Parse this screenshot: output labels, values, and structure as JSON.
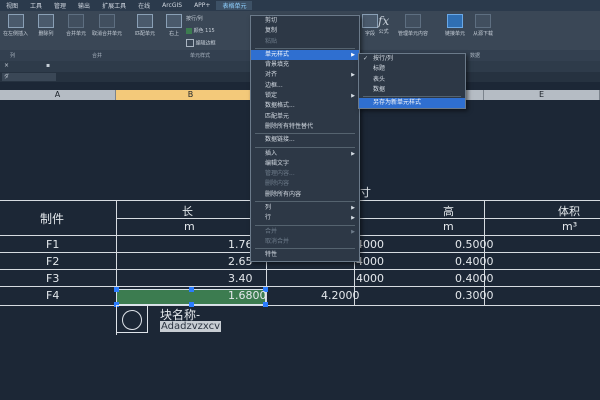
{
  "menubar": [
    "视图",
    "工具",
    "管理",
    "输出",
    "扩展工具",
    "在线",
    "ArcGIS",
    "APP+",
    "表格单元"
  ],
  "menubar_active_index": 8,
  "ribbon": {
    "buttons": [
      {
        "label": "在左侧插入"
      },
      {
        "label": "删除列"
      },
      {
        "label": "合并单元"
      },
      {
        "label": "取消合并单元"
      },
      {
        "label": "匹配单元"
      },
      {
        "label": "右上"
      },
      {
        "label": "按行/列"
      },
      {
        "label": "颜色 115"
      },
      {
        "label": "编辑边框"
      },
      {
        "label": "字段"
      },
      {
        "label": "公式"
      },
      {
        "label": "管理单元内容"
      },
      {
        "label": "链接单元"
      },
      {
        "label": "从源下载"
      }
    ],
    "panels": [
      "列",
      "合并",
      "单元样式",
      "数据"
    ]
  },
  "table": {
    "columns": [
      "A",
      "B",
      "C",
      "D",
      "E"
    ],
    "title_fragment": "寸",
    "header_row": [
      "制件",
      "长",
      "高",
      "体积"
    ],
    "unit_row": [
      "m",
      "m",
      "m³"
    ],
    "rows": [
      {
        "name": "F1",
        "b": "1.76",
        "c": "4000",
        "d": "0.5000"
      },
      {
        "name": "F2",
        "b": "2.65",
        "c": "4000",
        "d": "0.4000"
      },
      {
        "name": "F3",
        "b": "3.40",
        "c": "4000",
        "d": "0.4000"
      },
      {
        "name": "F4",
        "b": "1.6800",
        "c": "4.2000",
        "d": "0.3000"
      }
    ],
    "block_label": "块名称-",
    "block_value": "Adadzvzxcv"
  },
  "context_menu": {
    "items": [
      {
        "label": "剪切",
        "state": "normal"
      },
      {
        "label": "复制",
        "state": "normal"
      },
      {
        "label": "粘贴",
        "state": "disabled"
      },
      {
        "sep": true
      },
      {
        "label": "单元样式",
        "state": "highlight",
        "sub": true
      },
      {
        "label": "背景填充",
        "state": "normal"
      },
      {
        "label": "对齐",
        "state": "normal",
        "sub": true
      },
      {
        "label": "边框...",
        "state": "normal"
      },
      {
        "label": "锁定",
        "state": "normal",
        "sub": true
      },
      {
        "label": "数据格式...",
        "state": "normal"
      },
      {
        "label": "匹配单元",
        "state": "normal"
      },
      {
        "label": "删除所有特性替代",
        "state": "normal"
      },
      {
        "sep": true
      },
      {
        "label": "数据链接...",
        "state": "normal"
      },
      {
        "sep": true
      },
      {
        "label": "插入",
        "state": "normal",
        "sub": true
      },
      {
        "label": "编辑文字",
        "state": "normal"
      },
      {
        "label": "管理内容...",
        "state": "disabled"
      },
      {
        "label": "删除内容",
        "state": "disabled"
      },
      {
        "label": "删除所有内容",
        "state": "normal"
      },
      {
        "sep": true
      },
      {
        "label": "列",
        "state": "normal",
        "sub": true
      },
      {
        "label": "行",
        "state": "normal",
        "sub": true
      },
      {
        "sep": true
      },
      {
        "label": "合并",
        "state": "disabled",
        "sub": true
      },
      {
        "label": "取消合并",
        "state": "disabled"
      },
      {
        "sep": true
      },
      {
        "label": "特性",
        "state": "normal"
      }
    ]
  },
  "submenu": {
    "items": [
      {
        "label": "按行/列",
        "checked": true,
        "state": "normal"
      },
      {
        "label": "标题",
        "state": "normal"
      },
      {
        "label": "表头",
        "state": "normal"
      },
      {
        "label": "数据",
        "state": "normal"
      },
      {
        "sep": true
      },
      {
        "label": "另存为新单元样式",
        "state": "highlight"
      }
    ]
  }
}
